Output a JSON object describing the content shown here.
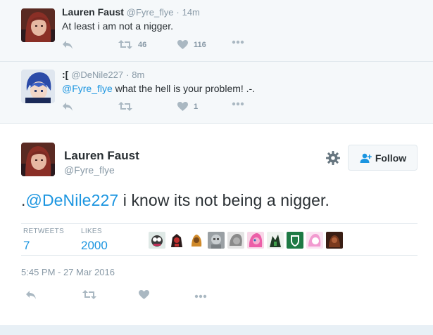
{
  "tweets": [
    {
      "name": "Lauren Faust",
      "handle": "@Fyre_flye",
      "separator": "·",
      "time": "14m",
      "text": "At least i am not a nigger.",
      "retweets": "46",
      "likes": "116"
    },
    {
      "name": ":[",
      "handle": "@DeNile227",
      "separator": "·",
      "time": "8m",
      "mention": "@Fyre_flye",
      "text": " what the hell is your problem! .-.",
      "retweets": "",
      "likes": "1"
    }
  ],
  "main": {
    "name": "Lauren Faust",
    "handle": "@Fyre_flye",
    "follow_label": "Follow",
    "prefix": ".",
    "mention": "@DeNile227",
    "text": " i know its not being a nigger.",
    "retweets_label": "RETWEETS",
    "retweets_value": "7",
    "likes_label": "LIKES",
    "likes_value": "2000",
    "date": "5:45 PM - 27 Mar 2016"
  },
  "icons": {
    "reply": "reply-icon",
    "retweet": "retweet-icon",
    "like": "heart-icon",
    "more": "more-icon",
    "gear": "gear-icon",
    "follow": "add-user-icon"
  },
  "colors": {
    "link": "#1b95e0",
    "muted": "#8899a6",
    "icon": "#aab8c2",
    "compact_bg": "#f5f8fa",
    "border": "#e1e8ed"
  }
}
